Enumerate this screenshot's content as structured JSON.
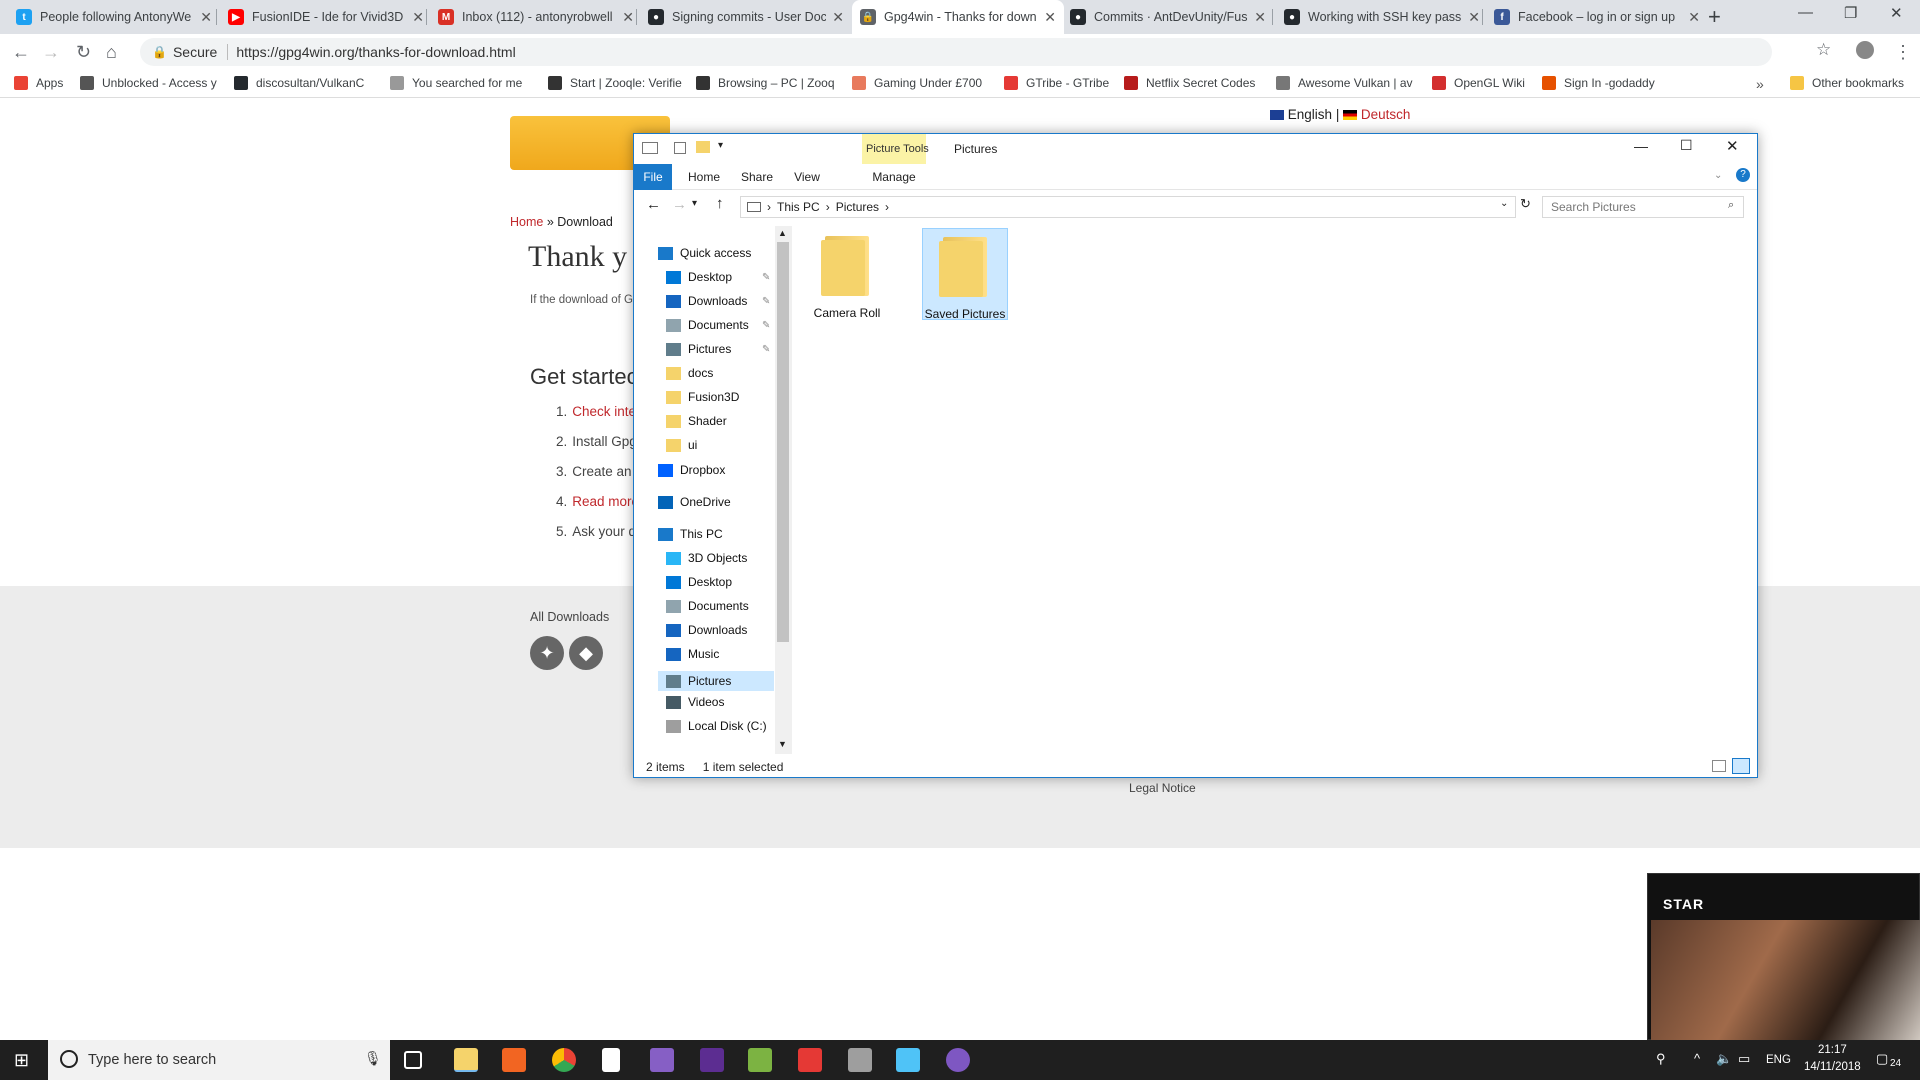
{
  "browser": {
    "tabs": [
      {
        "title": "People following AntonyWe",
        "color": "#1da1f2",
        "glyph": "t"
      },
      {
        "title": "FusionIDE - Ide for Vivid3D",
        "color": "#ff0000",
        "glyph": "▶"
      },
      {
        "title": "Inbox (112) - antonyrobwell",
        "color": "#d93025",
        "glyph": "M"
      },
      {
        "title": "Signing commits - User Doc",
        "color": "#24292e",
        "glyph": "●"
      },
      {
        "title": "Gpg4win - Thanks for down",
        "color": "#5f6368",
        "glyph": "🔒"
      },
      {
        "title": "Commits · AntDevUnity/Fus",
        "color": "#24292e",
        "glyph": "●"
      },
      {
        "title": "Working with SSH key pass",
        "color": "#24292e",
        "glyph": "●"
      },
      {
        "title": "Facebook – log in or sign up",
        "color": "#3b5998",
        "glyph": "f"
      }
    ],
    "secure_label": "Secure",
    "url": "https://gpg4win.org/thanks-for-download.html",
    "bookmarks": [
      {
        "label": "Apps",
        "color": "#ea4335"
      },
      {
        "label": "Unblocked - Access y",
        "color": "#555"
      },
      {
        "label": "discosultan/VulkanC",
        "color": "#24292e"
      },
      {
        "label": "You searched for me",
        "color": "#999"
      },
      {
        "label": "Start | Zooqle: Verifie",
        "color": "#333"
      },
      {
        "label": "Browsing – PC | Zooq",
        "color": "#333"
      },
      {
        "label": "Gaming Under £700",
        "color": "#e87a5d"
      },
      {
        "label": "GTribe - GTribe",
        "color": "#e53935"
      },
      {
        "label": "Netflix Secret Codes",
        "color": "#b71c1c"
      },
      {
        "label": "Awesome Vulkan | av",
        "color": "#777"
      },
      {
        "label": "OpenGL Wiki",
        "color": "#d32f2f"
      },
      {
        "label": "Sign In -godaddy",
        "color": "#e65100"
      }
    ],
    "other_bookmarks": "Other bookmarks"
  },
  "site": {
    "lang_en": "English",
    "lang_sep": "|",
    "lang_de": "Deutsch",
    "crumb_home": "Home",
    "crumb_sep": "»",
    "crumb_current": "Download",
    "title": "Thank y",
    "intro": "If the download of G",
    "get_started": "Get startec",
    "steps": [
      {
        "n": "1.",
        "text": "Check inte",
        "link": true
      },
      {
        "n": "2.",
        "text": "Install Gpg",
        "link": false
      },
      {
        "n": "3.",
        "text": "Create an",
        "link": false
      },
      {
        "n": "4.",
        "text": "Read more",
        "link": true
      },
      {
        "n": "5.",
        "text": "Ask your q",
        "link": false
      }
    ],
    "all_downloads": "All Downloads",
    "legal": "Legal Notice"
  },
  "explorer": {
    "title": "Pictures",
    "context_tab": "Picture Tools",
    "ribbon": [
      "File",
      "Home",
      "Share",
      "View",
      "Manage"
    ],
    "breadcrumb": [
      "This PC",
      "Pictures"
    ],
    "search_placeholder": "Search Pictures",
    "nav": {
      "quick_access": "Quick access",
      "quick_items": [
        "Desktop",
        "Downloads",
        "Documents",
        "Pictures",
        "docs",
        "Fusion3D",
        "Shader",
        "ui"
      ],
      "dropbox": "Dropbox",
      "onedrive": "OneDrive",
      "this_pc": "This PC",
      "pc_items": [
        "3D Objects",
        "Desktop",
        "Documents",
        "Downloads",
        "Music",
        "Pictures",
        "Videos",
        "Local Disk (C:)"
      ]
    },
    "items": [
      "Camera Roll",
      "Saved Pictures"
    ],
    "selected_item": "Saved Pictures",
    "status_count": "2 items",
    "status_selected": "1 item selected"
  },
  "video": {
    "label": "STAR"
  },
  "taskbar": {
    "search_placeholder": "Type here to search",
    "lang": "ENG",
    "time": "21:17",
    "date": "14/11/2018",
    "notifications": "24"
  }
}
